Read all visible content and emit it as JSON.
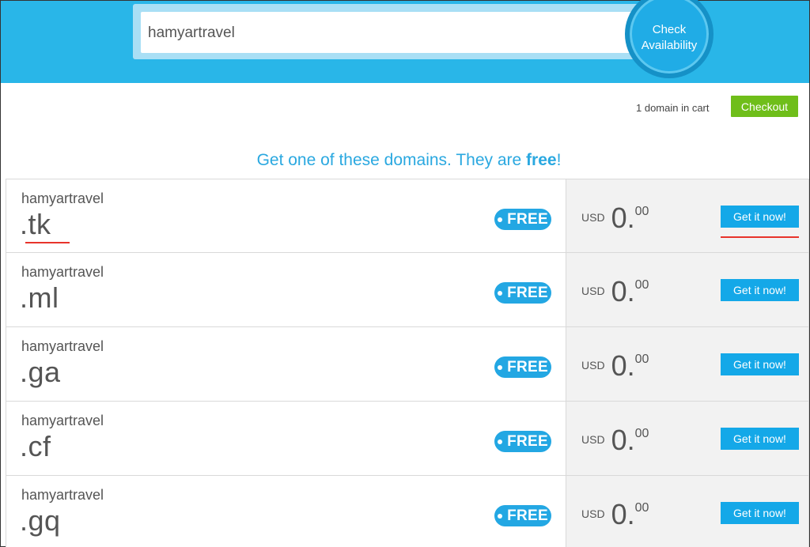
{
  "search": {
    "value": "hamyartravel",
    "check_label_line1": "Check",
    "check_label_line2": "Availability"
  },
  "cart": {
    "count_text": "1 domain in cart",
    "checkout_label": "Checkout"
  },
  "promo": {
    "heading_prefix": "Get one of these domains. They are ",
    "heading_strong": "free",
    "heading_suffix": "!"
  },
  "colors": {
    "header_bg": "#29b6e8",
    "accent_blue": "#14a8e8",
    "checkout_green": "#6fbe1a",
    "annotation_red": "#e8332b"
  },
  "domains": [
    {
      "name": "hamyartravel",
      "tld": ".tk",
      "badge": "FREE",
      "currency": "USD",
      "price_whole": "0.",
      "price_cents": "00",
      "button": "Get it now!"
    },
    {
      "name": "hamyartravel",
      "tld": ".ml",
      "badge": "FREE",
      "currency": "USD",
      "price_whole": "0.",
      "price_cents": "00",
      "button": "Get it now!"
    },
    {
      "name": "hamyartravel",
      "tld": ".ga",
      "badge": "FREE",
      "currency": "USD",
      "price_whole": "0.",
      "price_cents": "00",
      "button": "Get it now!"
    },
    {
      "name": "hamyartravel",
      "tld": ".cf",
      "badge": "FREE",
      "currency": "USD",
      "price_whole": "0.",
      "price_cents": "00",
      "button": "Get it now!"
    },
    {
      "name": "hamyartravel",
      "tld": ".gq",
      "badge": "FREE",
      "currency": "USD",
      "price_whole": "0.",
      "price_cents": "00",
      "button": "Get it now!"
    }
  ]
}
